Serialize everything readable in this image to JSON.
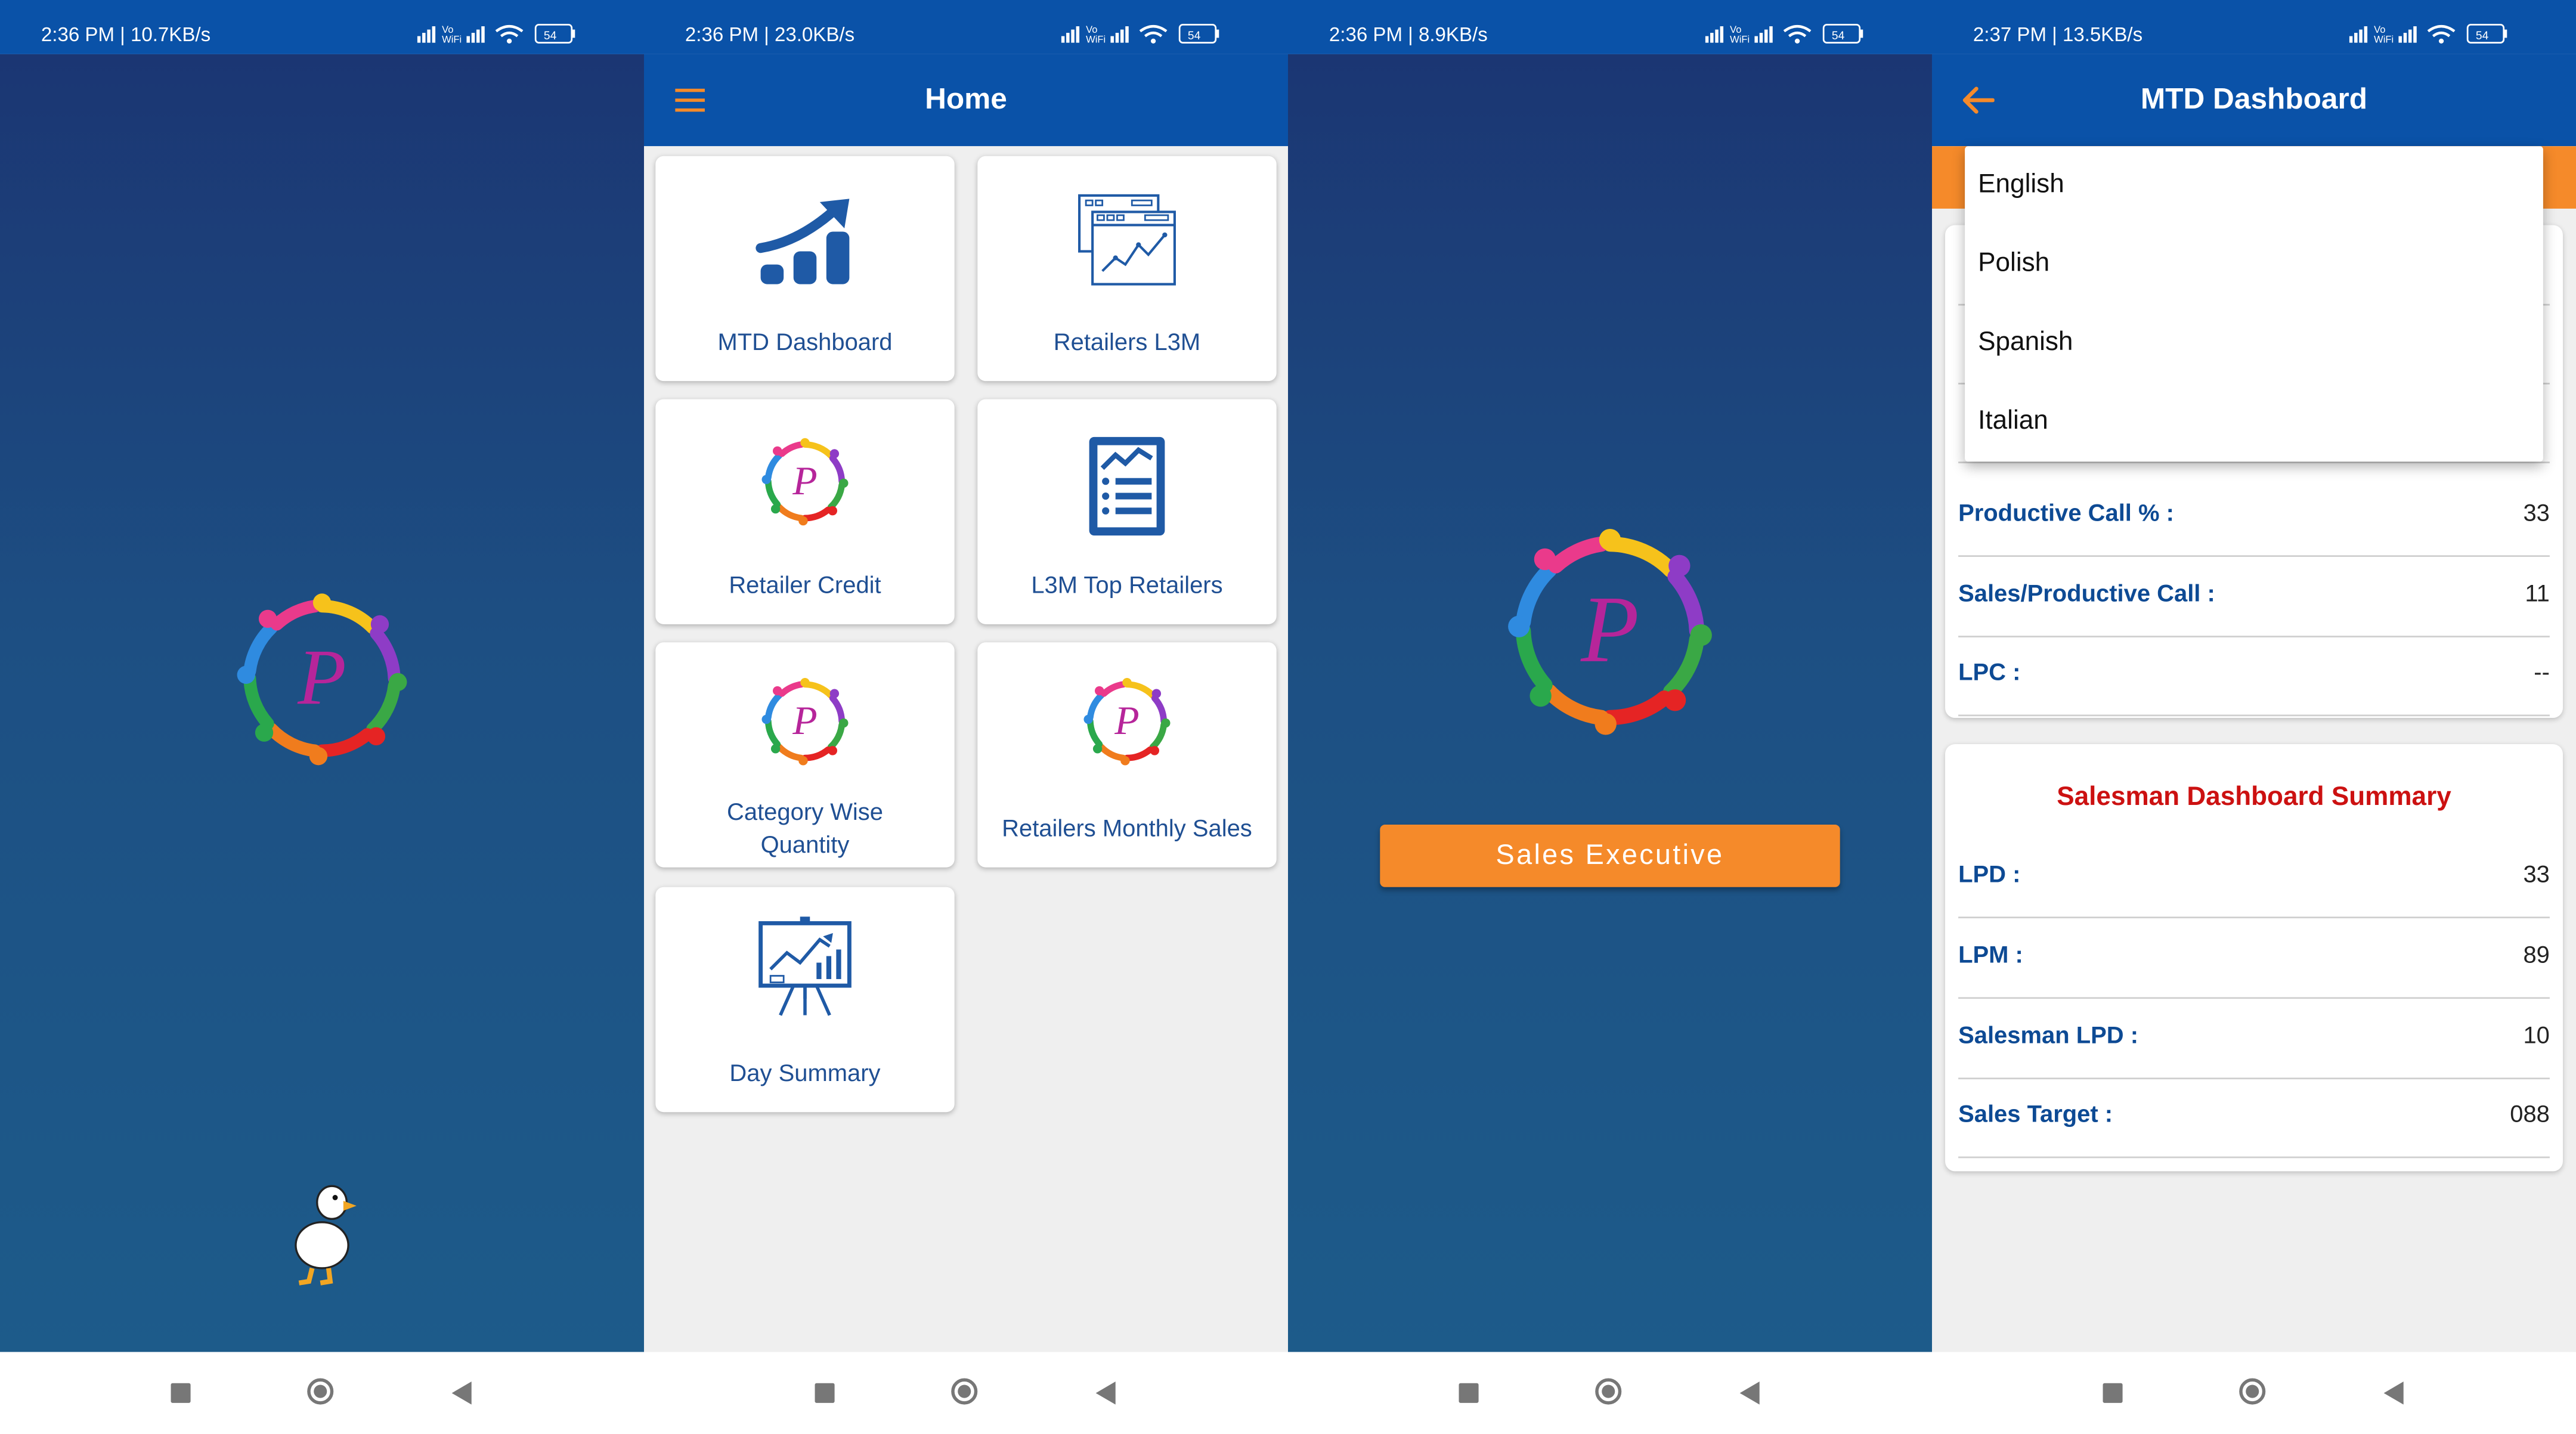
{
  "colors": {
    "primary_blue": "#0a52a8",
    "orange": "#f58a2a",
    "label_blue": "#0d4a94",
    "summary_red": "#cc1111",
    "splash_gradient_top": "#1b3673",
    "splash_gradient_bottom": "#1d5b8a"
  },
  "screen1": {
    "status": "2:36 PM | 10.7KB/s",
    "logo_icon": "colorful-people-circle-logo",
    "mascot_icon": "duck-mascot"
  },
  "screen2": {
    "status": "2:36 PM | 23.0KB/s",
    "title": "Home",
    "menu_icon": "hamburger-menu-icon",
    "tiles": [
      {
        "label": "MTD Dashboard",
        "icon": "growth-chart-icon"
      },
      {
        "label": "Retailers L3M",
        "icon": "browser-chart-icon"
      },
      {
        "label": "Retailer Credit",
        "icon": "colorful-people-circle-logo"
      },
      {
        "label": "L3M Top Retailers",
        "icon": "report-document-icon"
      },
      {
        "label": "Category Wise Quantity",
        "icon": "colorful-people-circle-logo"
      },
      {
        "label": "Retailers Monthly Sales",
        "icon": "colorful-people-circle-logo"
      },
      {
        "label": "Day Summary",
        "icon": "presentation-board-icon"
      }
    ]
  },
  "screen3": {
    "status": "2:36 PM | 8.9KB/s",
    "button_label": "Sales Executive",
    "logo_icon": "colorful-people-circle-logo"
  },
  "screen4": {
    "status": "2:37 PM | 13.5KB/s",
    "title": "MTD Dashboard",
    "back_icon": "arrow-left-icon",
    "language_options": [
      "English",
      "Polish",
      "Spanish",
      "Italian"
    ],
    "metrics": [
      {
        "label": "Productive Call % :",
        "value": "33"
      },
      {
        "label": "Sales/Productive Call :",
        "value": "11"
      },
      {
        "label": "LPC :",
        "value": "--"
      }
    ],
    "summary_title": "Salesman Dashboard Summary",
    "summary_rows": [
      {
        "label": "LPD :",
        "value": "33"
      },
      {
        "label": "LPM :",
        "value": "89"
      },
      {
        "label": "Salesman LPD :",
        "value": "10"
      },
      {
        "label": "Sales Target :",
        "value": "088"
      }
    ]
  }
}
